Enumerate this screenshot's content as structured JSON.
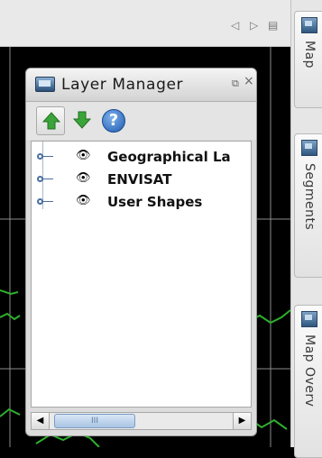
{
  "window": {
    "title": "Layer Manager"
  },
  "topbar": {
    "prev_glyph": "◁",
    "next_glyph": "▷",
    "menu_glyph": "▤"
  },
  "panel_controls": {
    "restore_glyph": "⧉",
    "close_glyph": "×"
  },
  "toolbar": {
    "buttons": [
      {
        "name": "move-up",
        "icon": "green-up-arrow-icon",
        "color": "#3aa43a"
      },
      {
        "name": "move-down",
        "icon": "green-down-arrow-icon",
        "color": "#3aa43a"
      },
      {
        "name": "help",
        "icon": "help-icon",
        "glyph": "?"
      }
    ]
  },
  "layers": [
    {
      "label": "Geographical La",
      "visibility_glyph": "👁",
      "visible": true
    },
    {
      "label": "ENVISAT",
      "visibility_glyph": "👁",
      "visible": true
    },
    {
      "label": "User Shapes",
      "visibility_glyph": "👁",
      "visible": true
    }
  ],
  "scrollbar": {
    "left_glyph": "◀",
    "right_glyph": "▶",
    "grip_glyph": "III",
    "position_fraction": 0.0
  },
  "side_tabs": [
    {
      "label": "Map",
      "icon": "map-icon"
    },
    {
      "label": "Segments",
      "icon": "segments-icon"
    },
    {
      "label": "Map Overv",
      "icon": "map-overview-icon"
    }
  ],
  "colors": {
    "map_background": "#000000",
    "coastline": "#2db12d",
    "grid": "#8c8c8c"
  }
}
